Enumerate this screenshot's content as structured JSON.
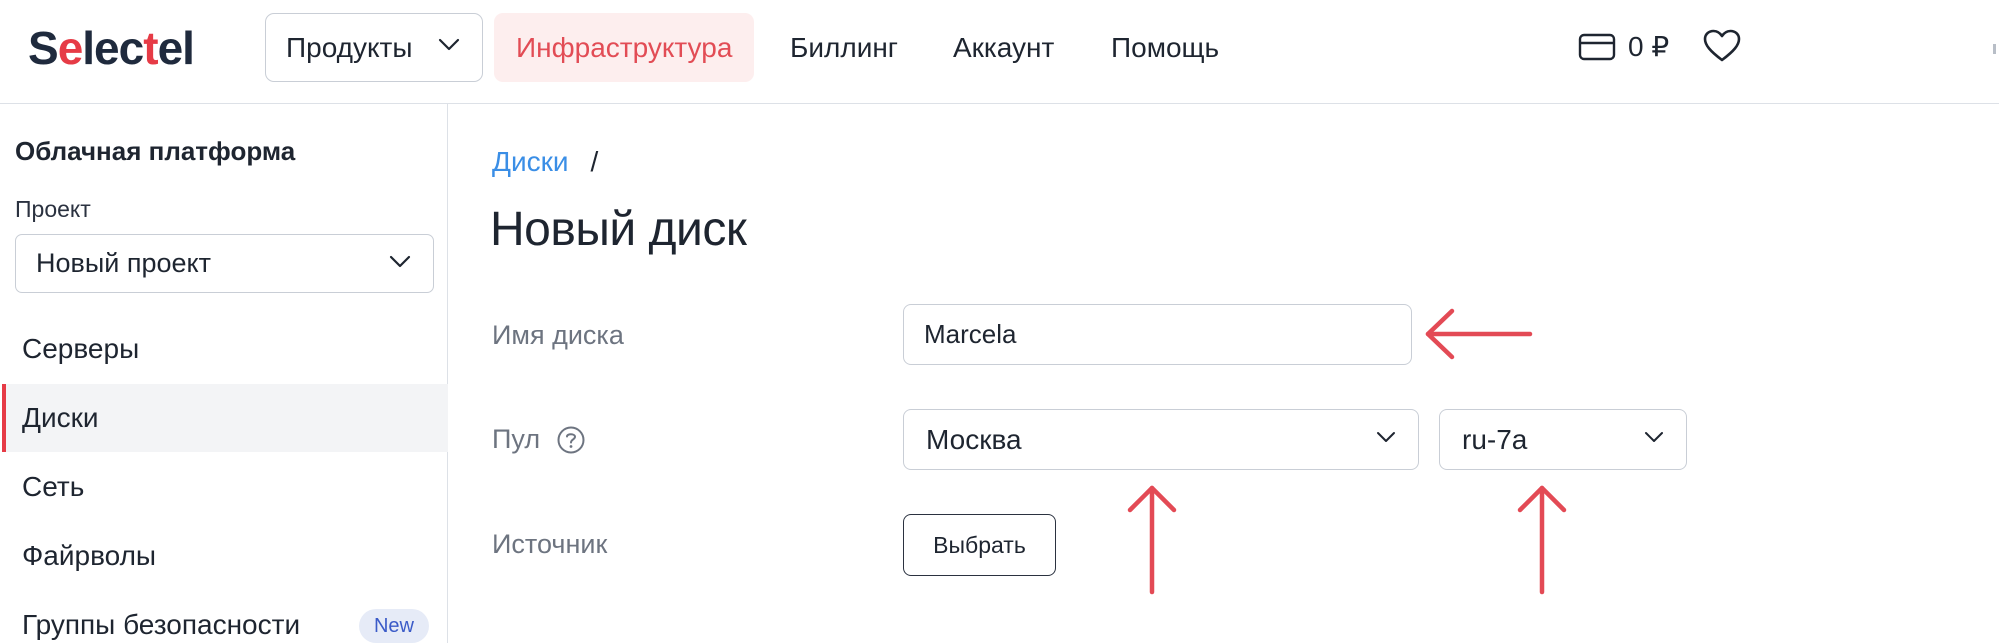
{
  "header": {
    "logo": {
      "pre": "S",
      "accent": "e",
      "mid": "lec",
      "accent2": "t",
      "post": "el"
    },
    "products_label": "Продукты",
    "nav": [
      {
        "label": "Инфраструктура",
        "active": true
      },
      {
        "label": "Биллинг",
        "active": false
      },
      {
        "label": "Аккаунт",
        "active": false
      },
      {
        "label": "Помощь",
        "active": false
      }
    ],
    "cart_amount": "0 ₽"
  },
  "sidebar": {
    "title": "Облачная платформа",
    "project_label": "Проект",
    "project_value": "Новый проект",
    "items": [
      {
        "label": "Серверы",
        "active": false
      },
      {
        "label": "Диски",
        "active": true
      },
      {
        "label": "Сеть",
        "active": false
      },
      {
        "label": "Файрволы",
        "active": false
      },
      {
        "label": "Группы безопасности",
        "active": false,
        "badge": "New"
      }
    ]
  },
  "main": {
    "breadcrumb": {
      "link": "Диски",
      "separator": "/"
    },
    "title": "Новый диск",
    "form": {
      "name_label": "Имя диска",
      "name_value": "Marcela",
      "pool_label": "Пул",
      "pool_region": "Москва",
      "pool_zone": "ru-7a",
      "source_label": "Источник",
      "source_button": "Выбрать"
    }
  },
  "colors": {
    "brand_red": "#e63b46",
    "active_nav_bg": "#fdeeee",
    "link_blue": "#3a8ee6",
    "annotation_red": "#e34a55"
  },
  "icons": [
    "chevron-down-icon",
    "wallet-icon",
    "heart-icon",
    "help-circle-icon",
    "arrow-left-icon",
    "arrow-up-icon"
  ]
}
